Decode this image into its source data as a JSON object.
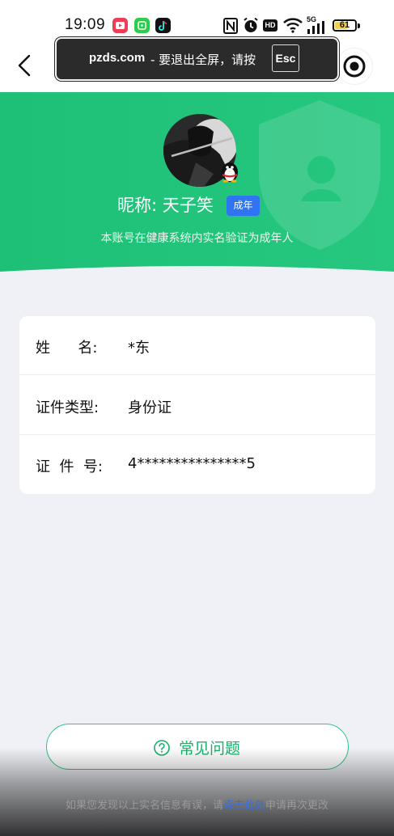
{
  "status_bar": {
    "time": "19:09",
    "battery_level": "61",
    "network": "5G",
    "hd_label": "HD"
  },
  "fullscreen_toast": {
    "host": "pzds.com",
    "message": "-  要退出全屏，请按",
    "key": "Esc"
  },
  "profile": {
    "nickname": "昵称: 天子笑",
    "badge": "成年",
    "verify_text": "本账号在健康系统内实名验证为成年人"
  },
  "info": {
    "rows": [
      {
        "label": "姓      名:",
        "value": "*东"
      },
      {
        "label": "证件类型:",
        "value": "身份证"
      },
      {
        "label": "证  件  号:",
        "value": "4***************5"
      }
    ]
  },
  "faq": {
    "label": "常见问题"
  },
  "footer": {
    "prefix": "如果您发现以上实名信息有误，请",
    "link": "点击此处",
    "suffix": "申请再次更改"
  },
  "colors": {
    "green_primary": "#1fc27a",
    "badge_blue": "#2f74f0",
    "link_blue": "#3a6fd8"
  }
}
